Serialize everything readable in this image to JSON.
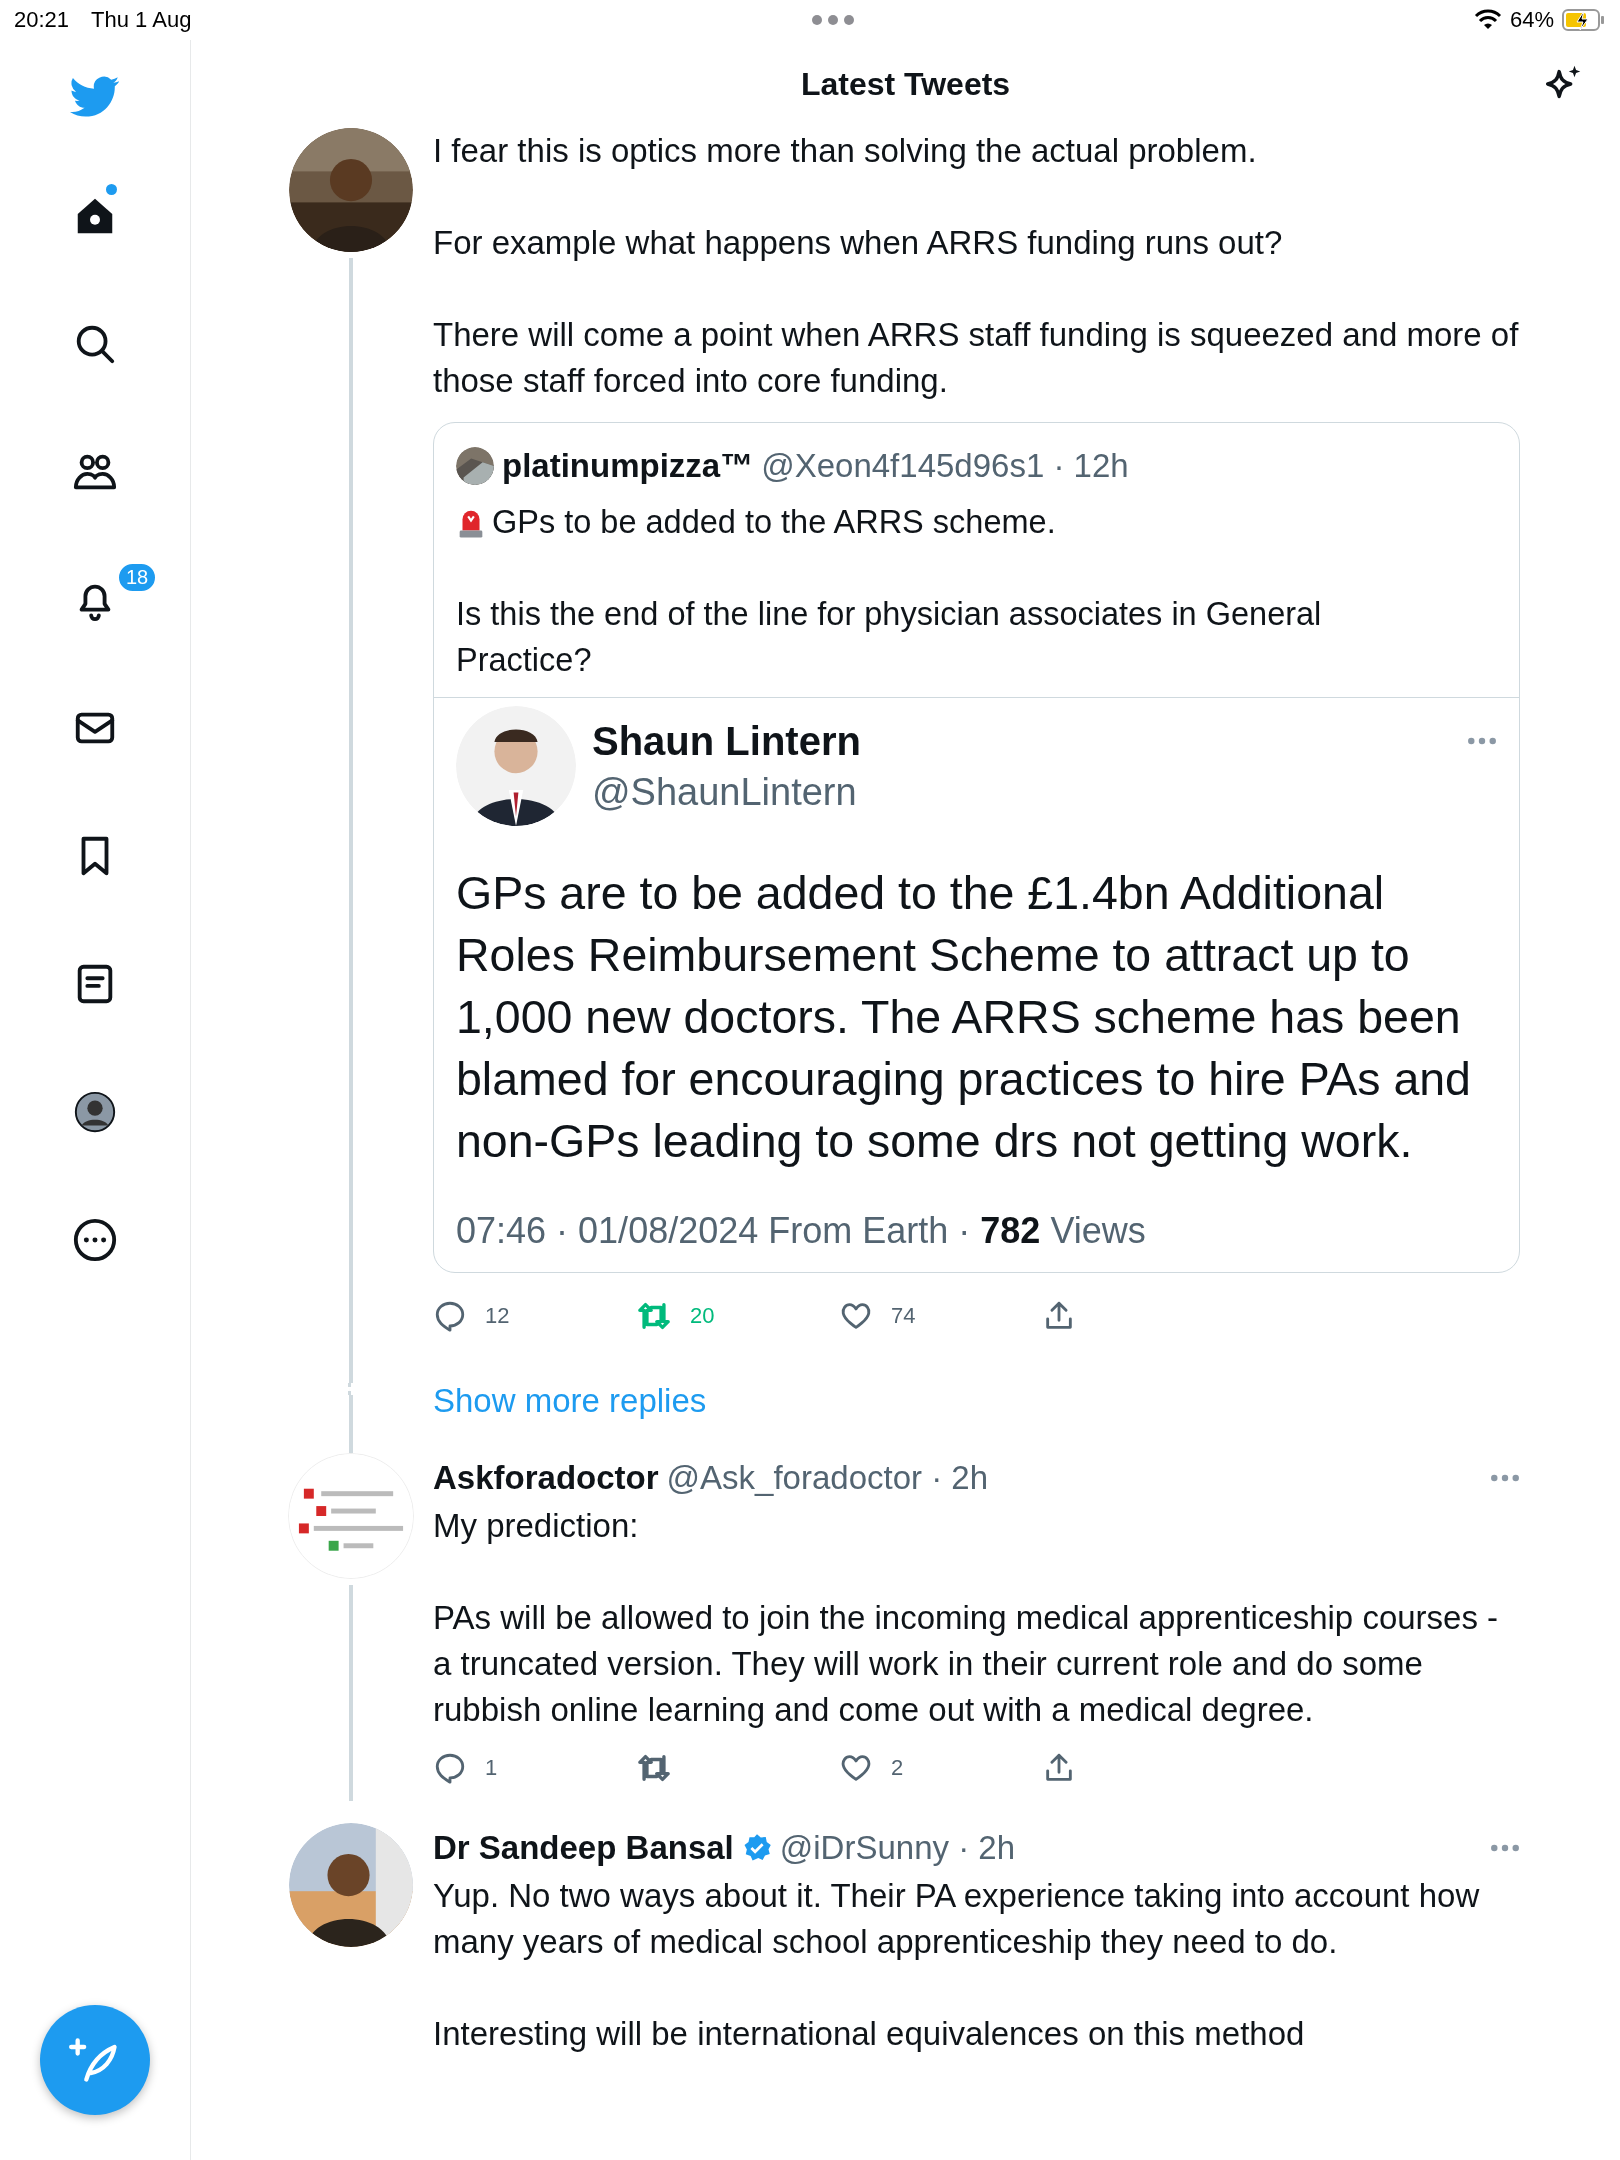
{
  "status_bar": {
    "time": "20:21",
    "date": "Thu 1 Aug",
    "battery": "64%",
    "charging": true
  },
  "header": {
    "title": "Latest Tweets"
  },
  "sidebar": {
    "items": [
      {
        "kind": "home",
        "selected": true,
        "unread": true
      },
      {
        "kind": "search",
        "selected": false,
        "unread": false
      },
      {
        "kind": "communities",
        "selected": false,
        "unread": false
      },
      {
        "kind": "notifications",
        "selected": false,
        "unread": false,
        "badge": "18"
      },
      {
        "kind": "messages",
        "selected": false,
        "unread": false
      },
      {
        "kind": "bookmarks",
        "selected": false,
        "unread": false
      },
      {
        "kind": "lists",
        "selected": false,
        "unread": false
      },
      {
        "kind": "profile",
        "selected": false,
        "unread": false
      },
      {
        "kind": "more",
        "selected": false,
        "unread": false
      }
    ]
  },
  "tweets": [
    {
      "paragraphs": [
        "I fear this is optics more than solving the actual problem.",
        "For example what happens when ARRS funding runs out?",
        "There will come a point when ARRS staff funding is squeezed and more of those staff forced into core funding."
      ],
      "quote": {
        "name": "platinumpizza™",
        "meta": "@Xeon4f145d96s1 · 12h",
        "paragraphs": [
          "GPs to be added to the ARRS scheme.",
          "Is this the end of the line for physician associates in General Practice?"
        ],
        "screenshot": {
          "name": "Shaun Lintern",
          "handle": "@ShaunLintern",
          "body": "GPs are to be added to the £1.4bn Additional Roles Reimbursement Scheme to attract up to 1,000 new doctors. The ARRS scheme has been blamed for encouraging practices to hire PAs and non-GPs leading to some drs not getting work.",
          "footer": "07:46 · 01/08/2024 From Earth · **782** Views"
        }
      },
      "actions": {
        "replies": "12",
        "retweets": "20",
        "likes": "74",
        "retweeted": true
      },
      "show_more": "Show more replies"
    },
    {
      "name": "Askforadoctor",
      "verified": false,
      "meta": "@Ask_foradoctor · 2h",
      "paragraphs": [
        "My prediction:",
        "PAs will be allowed to join the incoming medical apprenticeship courses - a truncated version. They will work in their current role and do some rubbish online learning and come out with a medical degree."
      ],
      "actions": {
        "replies": "1",
        "likes": "2",
        "retweeted": false
      }
    },
    {
      "name": "Dr Sandeep Bansal",
      "verified": true,
      "meta": "@iDrSunny · 2h",
      "paragraphs": [
        "Yup. No two ways about it. Their PA experience taking into account how many years of medical school apprenticeship they need to do.",
        "Interesting will be international equivalences on this method"
      ]
    }
  ]
}
